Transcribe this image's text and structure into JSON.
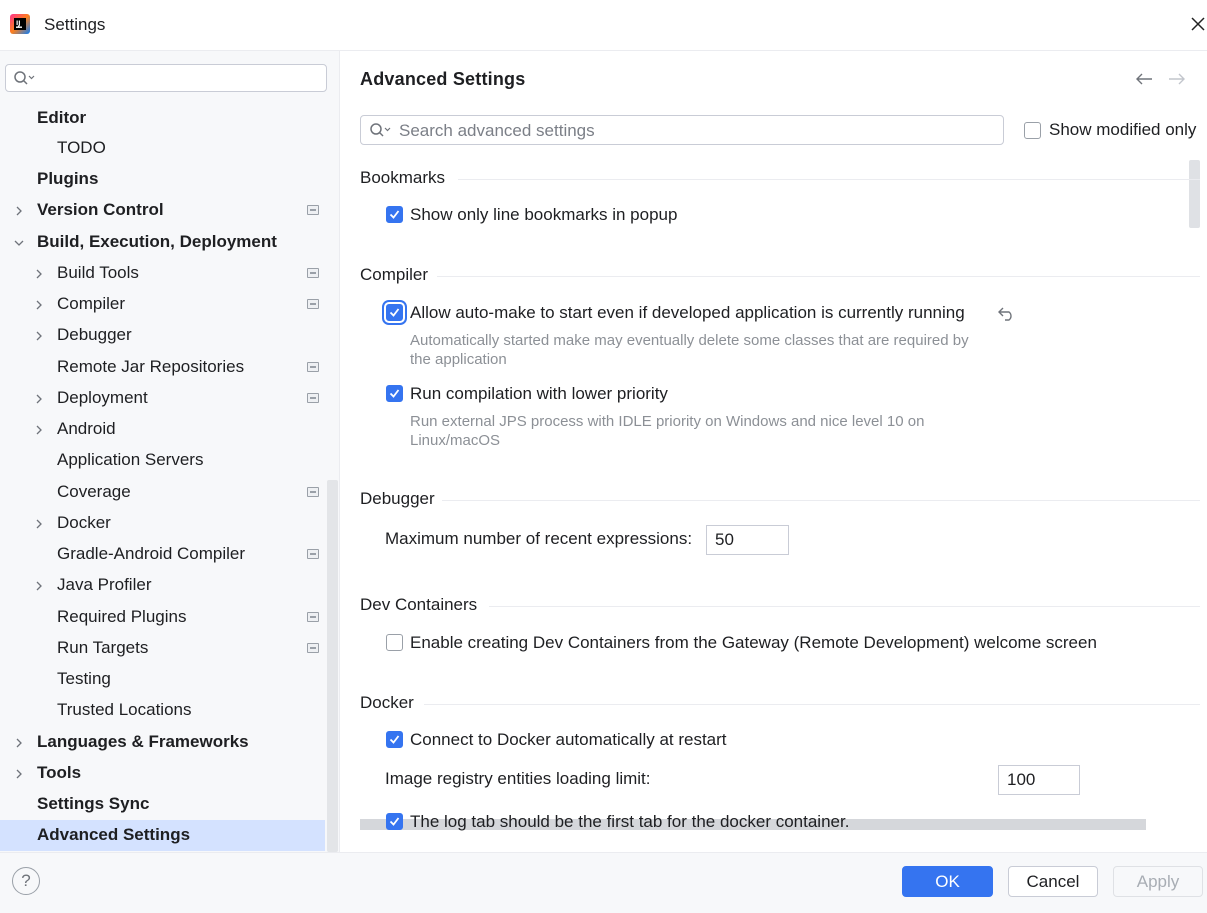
{
  "window": {
    "title": "Settings"
  },
  "sidebar": {
    "search_placeholder": "",
    "items": [
      {
        "label": "Editor",
        "bold": true
      },
      {
        "label": "TODO",
        "bold": false
      },
      {
        "label": "Plugins",
        "bold": true
      },
      {
        "label": "Version Control",
        "bold": true
      },
      {
        "label": "Build, Execution, Deployment",
        "bold": true
      },
      {
        "label": "Build Tools",
        "bold": false
      },
      {
        "label": "Compiler",
        "bold": false
      },
      {
        "label": "Debugger",
        "bold": false
      },
      {
        "label": "Remote Jar Repositories",
        "bold": false
      },
      {
        "label": "Deployment",
        "bold": false
      },
      {
        "label": "Android",
        "bold": false
      },
      {
        "label": "Application Servers",
        "bold": false
      },
      {
        "label": "Coverage",
        "bold": false
      },
      {
        "label": "Docker",
        "bold": false
      },
      {
        "label": "Gradle-Android Compiler",
        "bold": false
      },
      {
        "label": "Java Profiler",
        "bold": false
      },
      {
        "label": "Required Plugins",
        "bold": false
      },
      {
        "label": "Run Targets",
        "bold": false
      },
      {
        "label": "Testing",
        "bold": false
      },
      {
        "label": "Trusted Locations",
        "bold": false
      },
      {
        "label": "Languages & Frameworks",
        "bold": true
      },
      {
        "label": "Tools",
        "bold": true
      },
      {
        "label": "Settings Sync",
        "bold": true
      },
      {
        "label": "Advanced Settings",
        "bold": true,
        "selected": true
      }
    ]
  },
  "main": {
    "title": "Advanced Settings",
    "search_placeholder": "Search advanced settings",
    "show_modified_only": {
      "label": "Show modified only",
      "checked": false
    },
    "bookmarks": {
      "header": "Bookmarks",
      "show_line_bookmarks": {
        "label": "Show only line bookmarks in popup",
        "checked": true
      }
    },
    "compiler": {
      "header": "Compiler",
      "auto_make": {
        "label": "Allow auto-make to start even if developed application is currently running",
        "checked": true,
        "hint_line1": "Automatically started make may eventually delete some classes that are required by",
        "hint_line2": "the application"
      },
      "lower_priority": {
        "label": "Run compilation with lower priority",
        "checked": true,
        "hint_line1": "Run external JPS process with IDLE priority on Windows and nice level 10 on",
        "hint_line2": "Linux/macOS"
      }
    },
    "debugger": {
      "header": "Debugger",
      "max_expressions_label": "Maximum number of recent expressions:",
      "max_expressions_value": "50"
    },
    "dev_containers": {
      "header": "Dev Containers",
      "enable_label": "Enable creating Dev Containers from the Gateway (Remote Development) welcome screen",
      "checked": false
    },
    "docker": {
      "header": "Docker",
      "connect_auto": {
        "label": "Connect to Docker automatically at restart",
        "checked": true
      },
      "registry_limit_label": "Image registry entities loading limit:",
      "registry_limit_value": "100",
      "log_tab_first": {
        "label": "The log tab should be the first tab for the docker container.",
        "checked": true
      }
    }
  },
  "buttons": {
    "help": "?",
    "ok": "OK",
    "cancel": "Cancel",
    "apply": "Apply"
  },
  "colors": {
    "accent": "#3574f0",
    "selection": "#d4e2ff",
    "sidebar_bg": "#f7f8fa"
  }
}
